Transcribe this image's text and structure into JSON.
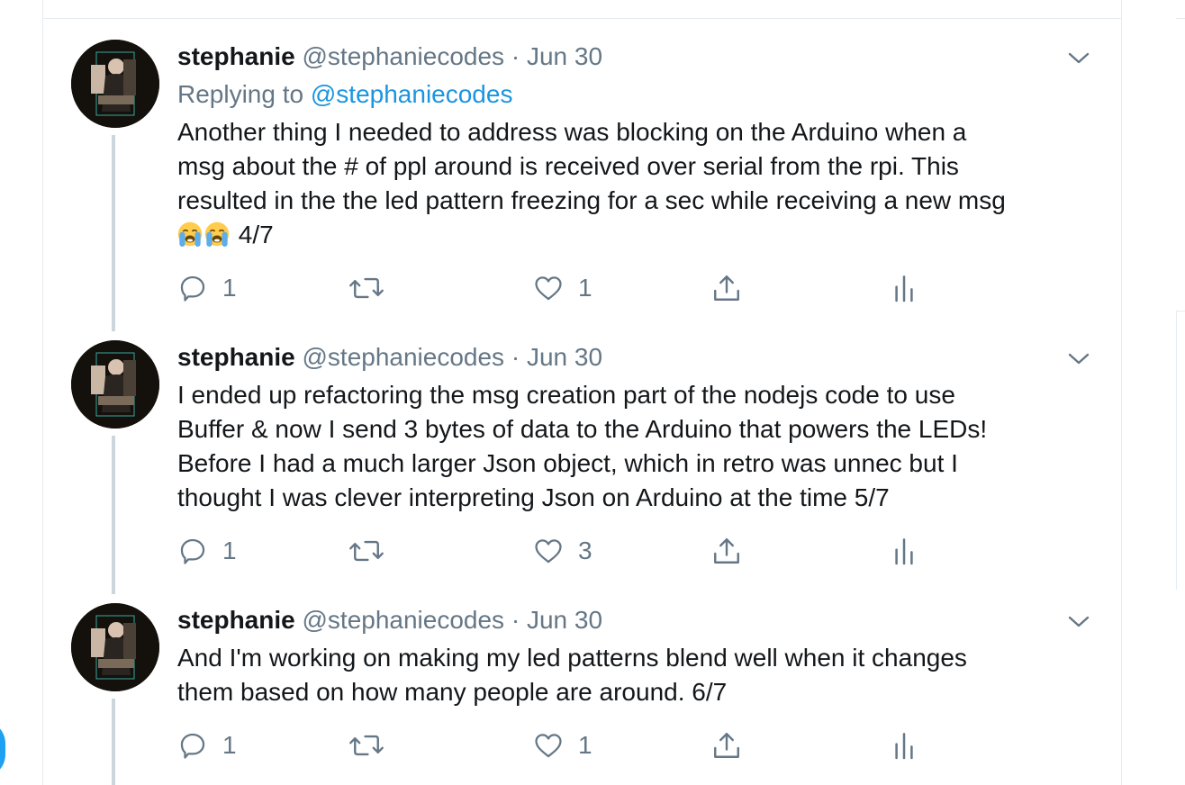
{
  "thread": {
    "tweets": [
      {
        "name": "stephanie",
        "handle": "@stephaniecodes",
        "separator": "·",
        "date": "Jun 30",
        "replying_prefix": "Replying to ",
        "replying_to": "@stephaniecodes",
        "text_lines": [
          "Another thing I needed to address was blocking on the Arduino when a",
          "msg about the # of ppl around is received over serial from the rpi. This",
          "resulted in the the led pattern freezing for a sec while receiving a new msg"
        ],
        "last_line_suffix": "4/7",
        "emoji": [
          "loudly-crying-face-emoji",
          "loudly-crying-face-emoji"
        ],
        "reply_count": "1",
        "retweet_count": "",
        "like_count": "1"
      },
      {
        "name": "stephanie",
        "handle": "@stephaniecodes",
        "separator": "·",
        "date": "Jun 30",
        "text_lines": [
          "I ended up refactoring the msg creation part of the nodejs code to use",
          "Buffer & now I send 3 bytes of data to the Arduino that powers the LEDs!",
          "Before I had a much larger Json object, which in retro was unnec but I",
          "thought I was clever interpreting Json on Arduino at the time 5/7"
        ],
        "reply_count": "1",
        "retweet_count": "",
        "like_count": "3"
      },
      {
        "name": "stephanie",
        "handle": "@stephaniecodes",
        "separator": "·",
        "date": "Jun 30",
        "text_lines": [
          "And I'm working on making my led patterns blend well when it changes",
          "them based on how many people are around.  6/7"
        ],
        "reply_count": "1",
        "retweet_count": "",
        "like_count": "1"
      }
    ]
  },
  "icons": {
    "reply": "reply-icon",
    "retweet": "retweet-icon",
    "like": "heart-icon",
    "share": "share-icon",
    "analytics": "analytics-icon",
    "more": "chevron-down-icon"
  },
  "colors": {
    "text": "#14171a",
    "secondary": "#657786",
    "link": "#1b95e0",
    "accent": "#1da1f2",
    "thread_line": "#ccd6dd",
    "border": "#e6ecf0"
  }
}
